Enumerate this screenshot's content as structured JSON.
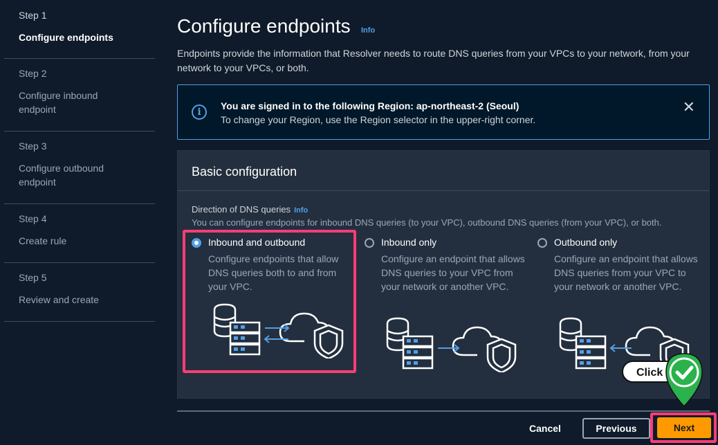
{
  "sidebar": {
    "steps": [
      {
        "num": "Step 1",
        "title": "Configure endpoints"
      },
      {
        "num": "Step 2",
        "title": "Configure inbound endpoint"
      },
      {
        "num": "Step 3",
        "title": "Configure outbound endpoint"
      },
      {
        "num": "Step 4",
        "title": "Create rule"
      },
      {
        "num": "Step 5",
        "title": "Review and create"
      }
    ]
  },
  "header": {
    "title": "Configure endpoints",
    "info": "Info",
    "description": "Endpoints provide the information that Resolver needs to route DNS queries from your VPCs to your network, from your network to your VPCs, or both."
  },
  "alert": {
    "icon": "info-circle-icon",
    "title": "You are signed in to the following Region: ap-northeast-2 (Seoul)",
    "text": "To change your Region, use the Region selector in the upper-right corner.",
    "close_icon": "close-icon"
  },
  "panel": {
    "title": "Basic configuration",
    "field_label": "Direction of DNS queries",
    "field_info": "Info",
    "field_description": "You can configure endpoints for inbound DNS queries (to your VPC), outbound DNS queries (from your VPC), or both.",
    "options": [
      {
        "label": "Inbound and outbound",
        "description": "Configure endpoints that allow DNS queries both to and from your VPC.",
        "selected": true
      },
      {
        "label": "Inbound only",
        "description": "Configure an endpoint that allows DNS queries to your VPC from your network or another VPC.",
        "selected": false
      },
      {
        "label": "Outbound only",
        "description": "Configure an endpoint that allows DNS queries from your VPC to your network or another VPC.",
        "selected": false
      }
    ]
  },
  "footer": {
    "cancel": "Cancel",
    "previous": "Previous",
    "next": "Next"
  },
  "overlay": {
    "click_label": "Click",
    "highlight_color": "#ff3d76",
    "check_color": "#2bb24c"
  },
  "colors": {
    "accent": "#539fe5",
    "primary_button": "#ff9900",
    "background": "#0f1b2a",
    "panel": "#232f3e"
  }
}
